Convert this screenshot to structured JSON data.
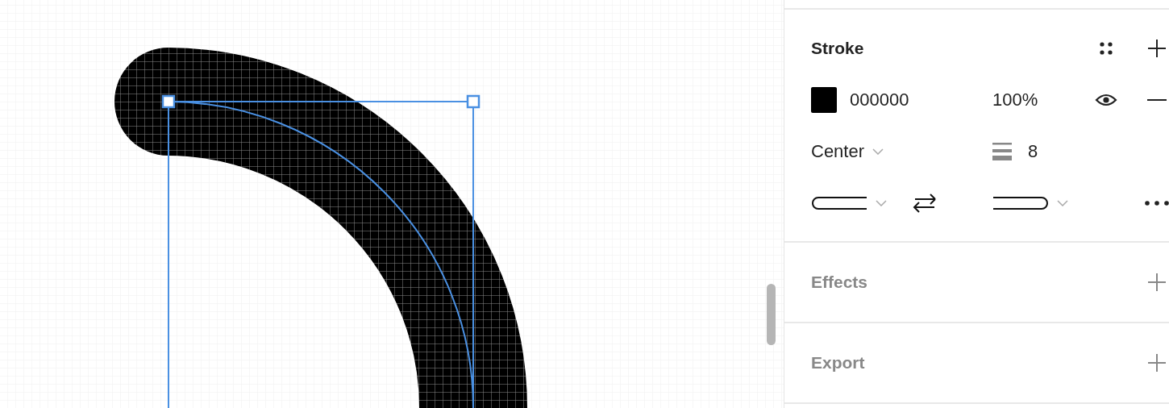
{
  "stroke": {
    "title": "Stroke",
    "hex": "000000",
    "opacity": "100%",
    "visible": true,
    "align": "Center",
    "weight": "8"
  },
  "sections": [
    {
      "title": "Effects"
    },
    {
      "title": "Export"
    }
  ]
}
